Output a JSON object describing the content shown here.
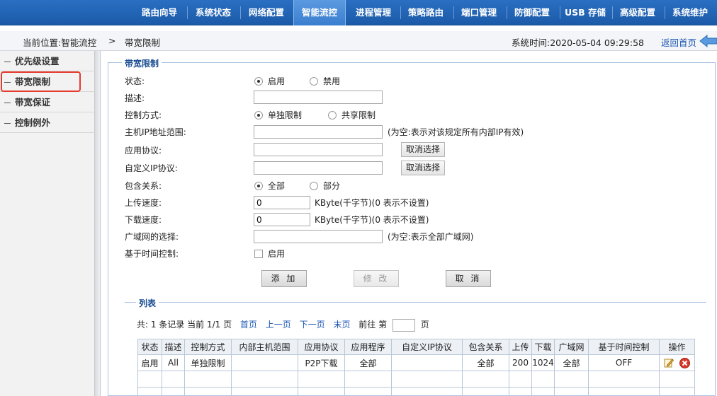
{
  "nav": {
    "items": [
      "路由向导",
      "系统状态",
      "网络配置",
      "智能流控",
      "进程管理",
      "策略路由",
      "端口管理",
      "防御配置",
      "USB 存储",
      "高级配置",
      "系统维护"
    ],
    "active_index": 3
  },
  "breadcrumb": {
    "prefix": "当前位置:智能流控",
    "separator": ">",
    "current": "带宽限制",
    "system_time": "系统时间:2020-05-04 09:29:58",
    "back_link": "返回首页"
  },
  "sidebar": {
    "items": [
      "优先级设置",
      "带宽限制",
      "带宽保证",
      "控制例外"
    ],
    "selected_index": 1
  },
  "form": {
    "legend": "带宽限制",
    "status_label": "状态:",
    "status_options": [
      "启用",
      "禁用"
    ],
    "status_selected": "启用",
    "description_label": "描述:",
    "description_value": "",
    "control_mode_label": "控制方式:",
    "control_mode_options": [
      "单独限制",
      "共享限制"
    ],
    "control_mode_selected": "单独限制",
    "host_ip_label": "主机IP地址范围:",
    "host_ip_value": "",
    "host_ip_hint": "(为空:表示对该规定所有内部IP有效)",
    "app_protocol_label": "应用协议:",
    "app_protocol_value": "",
    "cancel_select_label": "取消选择",
    "custom_ip_label": "自定义IP协议:",
    "custom_ip_value": "",
    "include_label": "包含关系:",
    "include_options": [
      "全部",
      "部分"
    ],
    "include_selected": "全部",
    "upload_label": "上传速度:",
    "upload_value": "0",
    "speed_hint": "KByte(千字节)(0 表示不设置)",
    "download_label": "下载速度:",
    "download_value": "0",
    "wan_label": "广域网的选择:",
    "wan_value": "",
    "wan_hint": "(为空:表示全部广域网)",
    "time_control_label": "基于时间控制:",
    "time_control_option": "启用",
    "time_control_checked": false,
    "add_button": "添 加",
    "modify_button": "修 改",
    "cancel_button": "取 消"
  },
  "list": {
    "legend": "列表",
    "summary": "共: 1 条记录 当前 1/1 页",
    "first_page": "首页",
    "prev_page": "上一页",
    "next_page": "下一页",
    "last_page": "末页",
    "goto_prefix": "前往 第",
    "goto_suffix": "页",
    "columns": [
      "状态",
      "描述",
      "控制方式",
      "内部主机范围",
      "应用协议",
      "应用程序",
      "自定义IP协议",
      "包含关系",
      "上传",
      "下载",
      "广域网",
      "基于时间控制",
      "操作"
    ],
    "rows": [
      [
        "启用",
        "All",
        "单独限制",
        "",
        "P2P下载",
        "全部",
        "",
        "全部",
        "200",
        "1024",
        "全部",
        "OFF",
        ""
      ]
    ]
  },
  "colors": {
    "nav_bg": "#1b5aa8",
    "link": "#1a55b4",
    "highlight_border": "#e43b2e",
    "legend_text": "#1b4d92"
  }
}
